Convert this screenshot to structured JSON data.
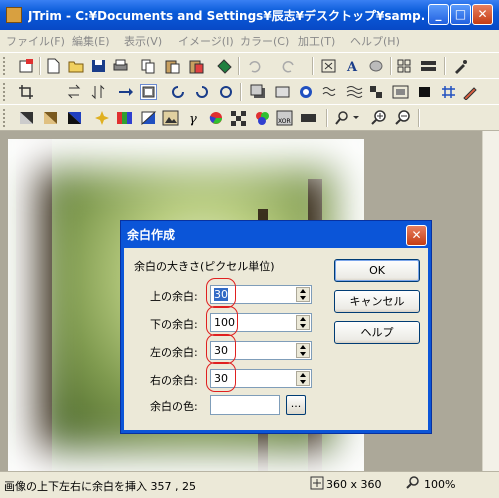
{
  "window": {
    "title": "JTrim - C:¥Documents and Settings¥辰志¥デスクトップ¥samp...",
    "minimize_label": "_",
    "maximize_label": "□",
    "close_label": "✕"
  },
  "menu": {
    "items": [
      {
        "label": "ファイル(F)"
      },
      {
        "label": "編集(E)"
      },
      {
        "label": "表示(V)"
      },
      {
        "label": "イメージ(I)"
      },
      {
        "label": "カラー(C)"
      },
      {
        "label": "加工(T)"
      },
      {
        "label": "ヘルプ(H)"
      }
    ]
  },
  "toolbar_icons": {
    "row1": [
      "open-recent-icon",
      "new-file-icon",
      "open-file-icon",
      "save-icon",
      "print-icon",
      "copy-icon",
      "paste-icon",
      "paste-new-icon",
      "send-icon",
      "undo-icon",
      "redo-icon",
      "fit-window-icon",
      "text-icon",
      "eraser-icon",
      "grid-view-icon",
      "dual-view-icon",
      "eyedropper-icon"
    ],
    "row2": [
      "crop-icon",
      "flip-horizontal-icon",
      "flip-vertical-icon",
      "resize-icon",
      "add-margin-icon",
      "rotate-left-icon",
      "rotate-90-icon",
      "rotate-free-icon",
      "shadow-icon",
      "frame-icon",
      "sharpen-icon",
      "wave-icon",
      "mosaic-icon",
      "emboss-icon",
      "border-icon",
      "hash-icon",
      "pencil-icon"
    ],
    "row3": [
      "grayscale-icon",
      "sepia-icon",
      "negative-icon",
      "sparkle-icon",
      "gradient-icon",
      "contrast-icon",
      "gamma-icon",
      "colorwheel-icon",
      "checker-icon",
      "rgb-icon",
      "xor-icon",
      "zoom-dropdown-icon",
      "zoom-in-icon",
      "zoom-out-icon"
    ]
  },
  "status": {
    "message": "画像の上下左右に余白を挿入 357 , 25",
    "size": "360 x 360",
    "zoom": "100%"
  },
  "dialog": {
    "title": "余白作成",
    "close_label": "✕",
    "group_label": "余白の大きさ(ピクセル単位)",
    "fields": [
      {
        "label": "上の余白:",
        "value": "30"
      },
      {
        "label": "下の余白:",
        "value": "100"
      },
      {
        "label": "左の余白:",
        "value": "30"
      },
      {
        "label": "右の余白:",
        "value": "30"
      }
    ],
    "color_label": "余白の色:",
    "color_button": "...",
    "ok_label": "OK",
    "cancel_label": "キャンセル",
    "help_label": "ヘルプ"
  },
  "colors": {
    "title_blue": "#0a5bd9",
    "highlight_red": "#e02020"
  }
}
